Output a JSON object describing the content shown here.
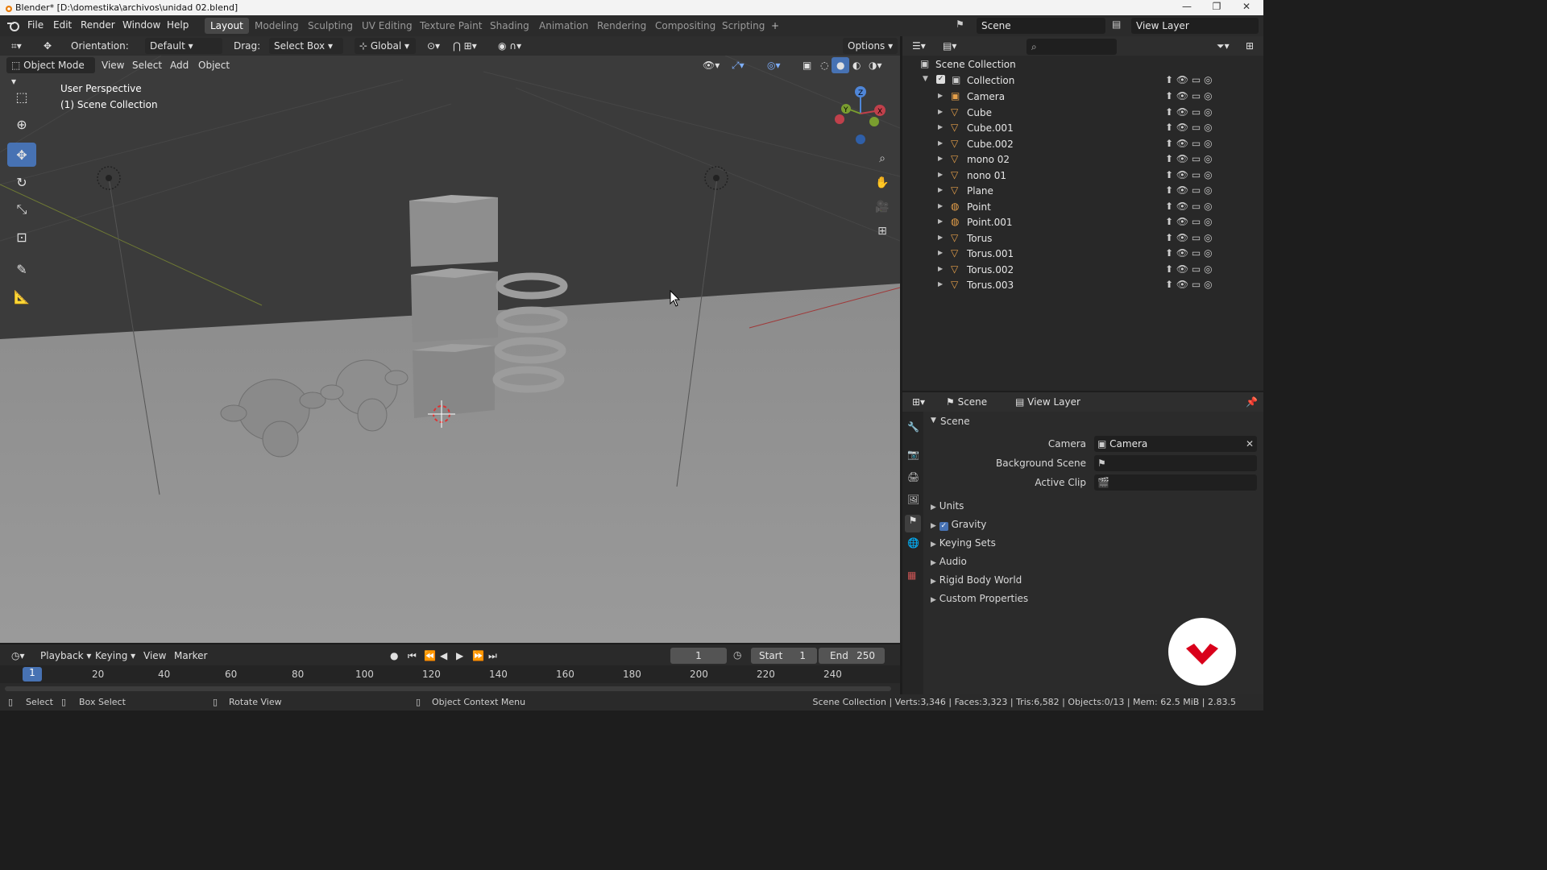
{
  "title_bar": {
    "title": "Blender* [D:\\domestika\\archivos\\unidad 02.blend]"
  },
  "menu": {
    "items": [
      "File",
      "Edit",
      "Render",
      "Window",
      "Help"
    ]
  },
  "workspaces": [
    "Layout",
    "Modeling",
    "Sculpting",
    "UV Editing",
    "Texture Paint",
    "Shading",
    "Animation",
    "Rendering",
    "Compositing",
    "Scripting"
  ],
  "scene_selector": {
    "scene": "Scene",
    "view_layer": "View Layer"
  },
  "tool_header": {
    "orientation_label": "Orientation:",
    "orientation_value": "Default",
    "drag_label": "Drag:",
    "drag_value": "Select Box",
    "transform_orientation": "Global",
    "options": "Options"
  },
  "viewport_header": {
    "mode": "Object Mode",
    "view": "View",
    "select": "Select",
    "add": "Add",
    "object": "Object"
  },
  "viewport": {
    "perspective": "User Perspective",
    "collection_info": "(1) Scene Collection"
  },
  "outliner": {
    "root": "Scene Collection",
    "collection": "Collection",
    "items": [
      "Camera",
      "Cube",
      "Cube.001",
      "Cube.002",
      "mono 02",
      "nono 01",
      "Plane",
      "Point",
      "Point.001",
      "Torus",
      "Torus.001",
      "Torus.002",
      "Torus.003"
    ]
  },
  "properties": {
    "tab_scene": "Scene",
    "tab_view_layer": "View Layer",
    "section": "Scene",
    "camera_label": "Camera",
    "camera_value": "Camera",
    "background_scene_label": "Background Scene",
    "active_clip_label": "Active Clip",
    "panels": [
      "Units",
      "Gravity",
      "Keying Sets",
      "Audio",
      "Rigid Body World",
      "Custom Properties"
    ]
  },
  "timeline": {
    "playback": "Playback",
    "keying": "Keying",
    "view": "View",
    "marker": "Marker",
    "current_frame": "1",
    "start_label": "Start",
    "start_value": "1",
    "end_label": "End",
    "end_value": "250",
    "ruler": [
      "1",
      "20",
      "40",
      "60",
      "80",
      "100",
      "120",
      "140",
      "160",
      "180",
      "200",
      "220",
      "240"
    ]
  },
  "status_bar": {
    "select": "Select",
    "box_select": "Box Select",
    "rotate_view": "Rotate View",
    "context_menu": "Object Context Menu",
    "stats": "Scene Collection | Verts:3,346 | Faces:3,323 | Tris:6,582 | Objects:0/13 | Mem: 62.5 MiB | 2.83.5"
  },
  "colors": {
    "accent": "#4772b3",
    "brand": "#e87d0d",
    "badge": "#d9001b"
  }
}
